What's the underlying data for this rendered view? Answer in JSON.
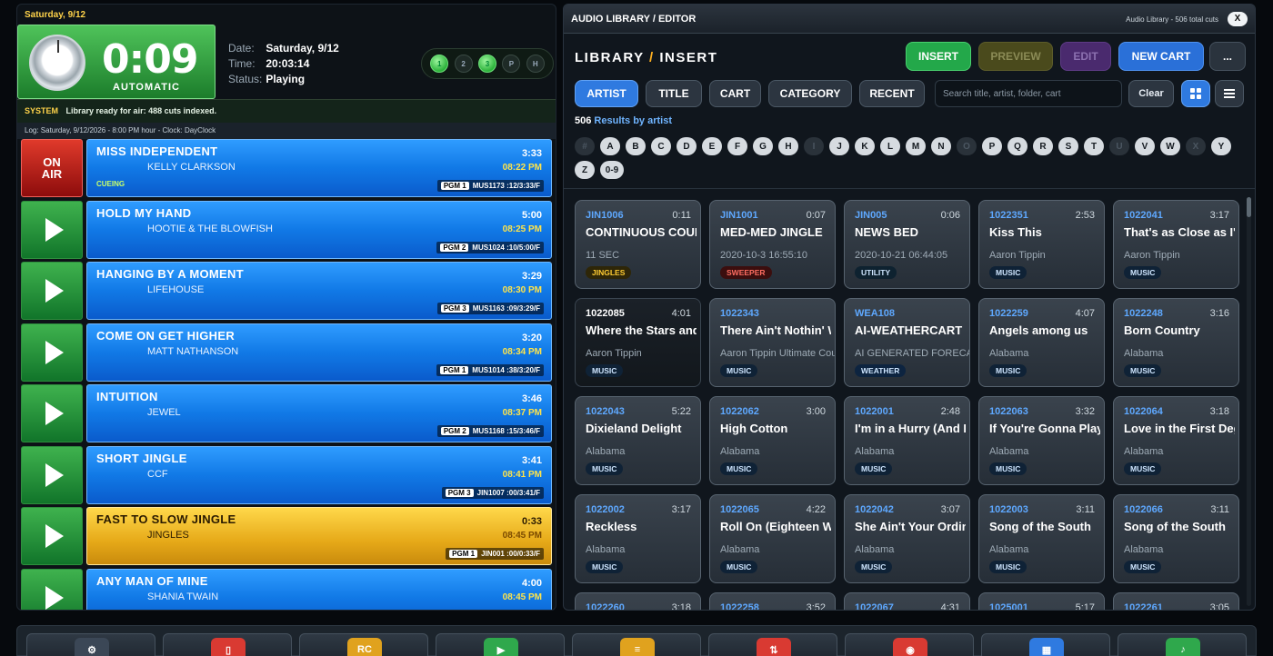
{
  "left": {
    "date_strip": "Saturday, 9/12",
    "timer": "0:09",
    "mode": "AUTOMATIC",
    "info": {
      "date_label": "Date:",
      "date_value": "Saturday, 9/12",
      "time_label": "Time:",
      "time_value": "20:03:14",
      "status_label": "Status:",
      "status_value": "Playing"
    },
    "pgm_lights": [
      {
        "label": "1",
        "on": true
      },
      {
        "label": "2",
        "on": false
      },
      {
        "label": "3",
        "on": true
      },
      {
        "label": "P",
        "on": false
      },
      {
        "label": "H",
        "on": false
      }
    ],
    "system_tag": "SYSTEM",
    "system_msg": "Library ready for air: 488 cuts indexed.",
    "log_info": "Log: Saturday, 9/12/2026 - 8:00 PM hour - Clock: DayClock",
    "on_air_label": [
      "ON",
      "AIR"
    ],
    "log": [
      {
        "title": "MISS INDEPENDENT",
        "artist": "KELLY CLARKSON",
        "dur": "3:33",
        "time": "08:22 PM",
        "pgm": "PGM 1",
        "code": "MUS1173 :12/3:33/F",
        "cue": "CUEING",
        "onair": true,
        "jingle": false
      },
      {
        "title": "HOLD MY HAND",
        "artist": "HOOTIE & THE BLOWFISH",
        "dur": "5:00",
        "time": "08:25 PM",
        "pgm": "PGM 2",
        "code": "MUS1024 :10/5:00/F",
        "cue": "",
        "onair": false,
        "jingle": false
      },
      {
        "title": "HANGING BY A MOMENT",
        "artist": "LIFEHOUSE",
        "dur": "3:29",
        "time": "08:30 PM",
        "pgm": "PGM 3",
        "code": "MUS1163 :09/3:29/F",
        "cue": "",
        "onair": false,
        "jingle": false
      },
      {
        "title": "COME ON GET HIGHER",
        "artist": "MATT NATHANSON",
        "dur": "3:20",
        "time": "08:34 PM",
        "pgm": "PGM 1",
        "code": "MUS1014 :38/3:20/F",
        "cue": "",
        "onair": false,
        "jingle": false
      },
      {
        "title": "INTUITION",
        "artist": "JEWEL",
        "dur": "3:46",
        "time": "08:37 PM",
        "pgm": "PGM 2",
        "code": "MUS1168 :15/3:46/F",
        "cue": "",
        "onair": false,
        "jingle": false
      },
      {
        "title": "SHORT JINGLE",
        "artist": "CCF",
        "dur": "3:41",
        "time": "08:41 PM",
        "pgm": "PGM 3",
        "code": "JIN1007 :00/3:41/F",
        "cue": "",
        "onair": false,
        "jingle": false
      },
      {
        "title": "FAST TO SLOW JINGLE",
        "artist": "JINGLES",
        "dur": "0:33",
        "time": "08:45 PM",
        "pgm": "PGM 1",
        "code": "JIN001 :00/0:33/F",
        "cue": "",
        "onair": false,
        "jingle": true
      },
      {
        "title": "ANY MAN OF MINE",
        "artist": "SHANIA TWAIN",
        "dur": "4:00",
        "time": "08:45 PM",
        "pgm": "",
        "code": "",
        "cue": "",
        "onair": false,
        "jingle": false
      }
    ]
  },
  "right": {
    "header_title": "AUDIO LIBRARY / EDITOR",
    "header_count": "Audio Library - 506 total cuts",
    "close_label": "X",
    "title_a": "LIBRARY",
    "title_sep": "/",
    "title_b": "INSERT",
    "buttons": {
      "insert": "INSERT",
      "preview": "PREVIEW",
      "edit": "EDIT",
      "new_cart": "NEW CART",
      "more": "..."
    },
    "tabs": [
      "ARTIST",
      "TITLE",
      "CART",
      "CATEGORY",
      "RECENT"
    ],
    "search_placeholder": "Search title, artist, folder, cart",
    "clear_label": "Clear",
    "results_count": "506",
    "results_text": "Results by artist",
    "alphabet": [
      {
        "l": "#",
        "d": true
      },
      {
        "l": "A",
        "d": false
      },
      {
        "l": "B",
        "d": false
      },
      {
        "l": "C",
        "d": false
      },
      {
        "l": "D",
        "d": false
      },
      {
        "l": "E",
        "d": false
      },
      {
        "l": "F",
        "d": false
      },
      {
        "l": "G",
        "d": false
      },
      {
        "l": "H",
        "d": false
      },
      {
        "l": "I",
        "d": true
      },
      {
        "l": "J",
        "d": false
      },
      {
        "l": "K",
        "d": false
      },
      {
        "l": "L",
        "d": false
      },
      {
        "l": "M",
        "d": false
      },
      {
        "l": "N",
        "d": false
      },
      {
        "l": "O",
        "d": true
      },
      {
        "l": "P",
        "d": false
      },
      {
        "l": "Q",
        "d": false
      },
      {
        "l": "R",
        "d": false
      },
      {
        "l": "S",
        "d": false
      },
      {
        "l": "T",
        "d": false
      },
      {
        "l": "U",
        "d": true
      },
      {
        "l": "V",
        "d": false
      },
      {
        "l": "W",
        "d": false
      },
      {
        "l": "X",
        "d": true
      },
      {
        "l": "Y",
        "d": false
      },
      {
        "l": "Z",
        "d": false
      },
      {
        "l": "0-9",
        "d": false
      }
    ],
    "cards": [
      {
        "id": "JIN1006",
        "dur": "0:11",
        "title": "CONTINUOUS COUNTRY",
        "artist": "11 SEC",
        "badge": "JINGLES",
        "kind": "jingles"
      },
      {
        "id": "JIN1001",
        "dur": "0:07",
        "title": "MED-MED JINGLE",
        "artist": "2020-10-3 16:55:10",
        "badge": "SWEEPER",
        "kind": "sweeper"
      },
      {
        "id": "JIN005",
        "dur": "0:06",
        "title": "NEWS BED",
        "artist": "2020-10-21 06:44:05",
        "badge": "UTILITY",
        "kind": "utility"
      },
      {
        "id": "1022351",
        "dur": "2:53",
        "title": "Kiss This",
        "artist": "Aaron Tippin",
        "badge": "MUSIC",
        "kind": "music"
      },
      {
        "id": "1022041",
        "dur": "3:17",
        "title": "That's as Close as I'll Get to",
        "artist": "Aaron Tippin",
        "badge": "MUSIC",
        "kind": "music"
      },
      {
        "id": "1022085",
        "dur": "4:01",
        "title": "Where the Stars and Stripes",
        "artist": "Aaron Tippin",
        "badge": "MUSIC",
        "kind": "music",
        "dark": true
      },
      {
        "id": "1022343",
        "dur": "",
        "title": "There Ain't Nothin' Wrong With Radio",
        "artist": "Aaron Tippin Ultimate Country",
        "badge": "MUSIC",
        "kind": "music"
      },
      {
        "id": "WEA108",
        "dur": "",
        "title": "AI-WEATHERCART",
        "artist": "AI GENERATED FORECAST",
        "badge": "WEATHER",
        "kind": "weather"
      },
      {
        "id": "1022259",
        "dur": "4:07",
        "title": "Angels among us",
        "artist": "Alabama",
        "badge": "MUSIC",
        "kind": "music"
      },
      {
        "id": "1022248",
        "dur": "3:16",
        "title": "Born Country",
        "artist": "Alabama",
        "badge": "MUSIC",
        "kind": "music"
      },
      {
        "id": "1022043",
        "dur": "5:22",
        "title": "Dixieland Delight",
        "artist": "Alabama",
        "badge": "MUSIC",
        "kind": "music"
      },
      {
        "id": "1022062",
        "dur": "3:00",
        "title": "High Cotton",
        "artist": "Alabama",
        "badge": "MUSIC",
        "kind": "music"
      },
      {
        "id": "1022001",
        "dur": "2:48",
        "title": "I'm in a Hurry (And Don't Know Why)",
        "artist": "Alabama",
        "badge": "MUSIC",
        "kind": "music"
      },
      {
        "id": "1022063",
        "dur": "3:32",
        "title": "If You're Gonna Play in Texas",
        "artist": "Alabama",
        "badge": "MUSIC",
        "kind": "music"
      },
      {
        "id": "1022064",
        "dur": "3:18",
        "title": "Love in the First Degree",
        "artist": "Alabama",
        "badge": "MUSIC",
        "kind": "music"
      },
      {
        "id": "1022002",
        "dur": "3:17",
        "title": "Reckless",
        "artist": "Alabama",
        "badge": "MUSIC",
        "kind": "music"
      },
      {
        "id": "1022065",
        "dur": "4:22",
        "title": "Roll On (Eighteen Wheeler)",
        "artist": "Alabama",
        "badge": "MUSIC",
        "kind": "music"
      },
      {
        "id": "1022042",
        "dur": "3:07",
        "title": "She Ain't Your Ordinary Girl",
        "artist": "Alabama",
        "badge": "MUSIC",
        "kind": "music"
      },
      {
        "id": "1022003",
        "dur": "3:11",
        "title": "Song of the South",
        "artist": "Alabama",
        "badge": "MUSIC",
        "kind": "music"
      },
      {
        "id": "1022066",
        "dur": "3:11",
        "title": "Song of the South",
        "artist": "Alabama",
        "badge": "MUSIC",
        "kind": "music"
      },
      {
        "id": "1022260",
        "dur": "3:18",
        "title": "",
        "artist": "",
        "badge": "",
        "kind": "music"
      },
      {
        "id": "1022258",
        "dur": "3:52",
        "title": "",
        "artist": "",
        "badge": "",
        "kind": "music"
      },
      {
        "id": "1022067",
        "dur": "4:31",
        "title": "",
        "artist": "",
        "badge": "",
        "kind": "music"
      },
      {
        "id": "1025001",
        "dur": "5:17",
        "title": "",
        "artist": "",
        "badge": "",
        "kind": "music"
      },
      {
        "id": "1022261",
        "dur": "3:05",
        "title": "",
        "artist": "",
        "badge": "",
        "kind": "music"
      }
    ]
  },
  "bottom": [
    {
      "name": "settings",
      "icon": "gear-icon",
      "label": "⚙",
      "color": "#3b4756"
    },
    {
      "name": "device",
      "icon": "device-icon",
      "label": "▯",
      "color": "#d93a32"
    },
    {
      "name": "rc",
      "icon": "rc-icon",
      "label": "RC",
      "color": "#e0a21e"
    },
    {
      "name": "play",
      "icon": "play-icon",
      "label": "▶",
      "color": "#2fa84c"
    },
    {
      "name": "notes",
      "icon": "notes-icon",
      "label": "≡",
      "color": "#e0a21e"
    },
    {
      "name": "sort",
      "icon": "sort-icon",
      "label": "⇅",
      "color": "#d93a32"
    },
    {
      "name": "record",
      "icon": "record-icon",
      "label": "◉",
      "color": "#d93a32"
    },
    {
      "name": "grid",
      "icon": "grid-icon",
      "label": "▦",
      "color": "#2f7ae0"
    },
    {
      "name": "music",
      "icon": "music-note-icon",
      "label": "♪",
      "color": "#2fa84c"
    }
  ]
}
